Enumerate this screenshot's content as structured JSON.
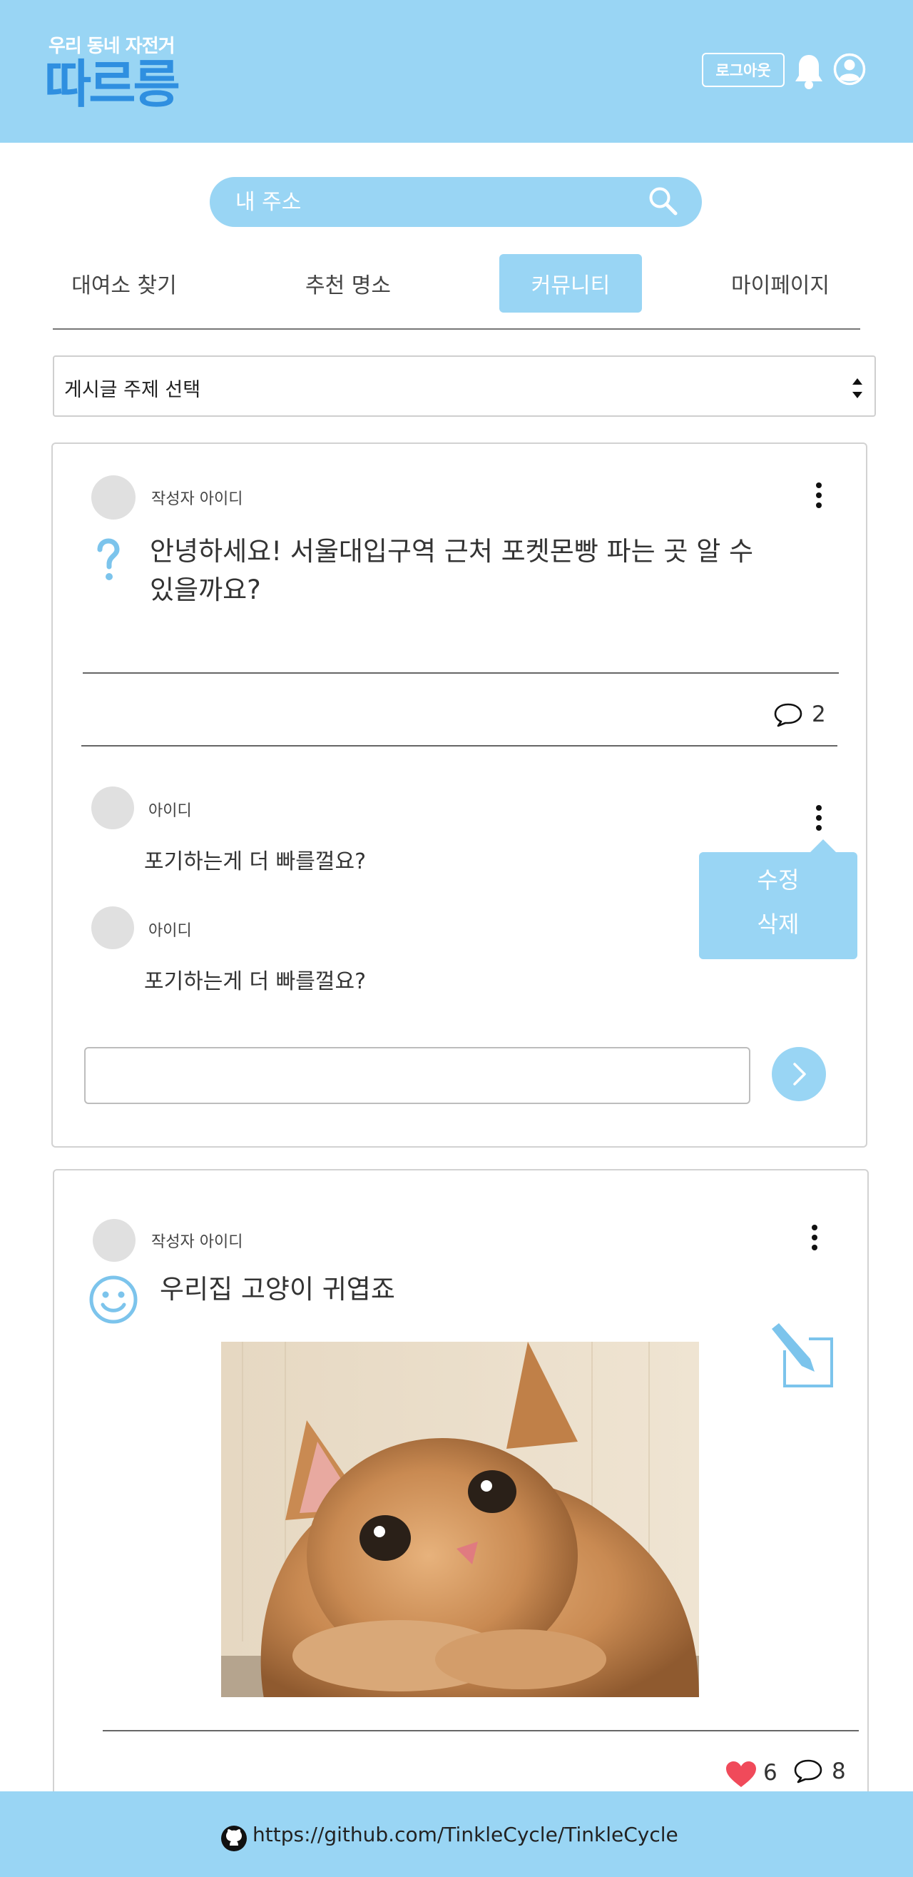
{
  "header": {
    "subtitle": "우리 동네 자전거",
    "logo": "따르릉",
    "logout_label": "로그아웃"
  },
  "search": {
    "placeholder": "내 주소"
  },
  "tabs": [
    {
      "label": "대여소 찾기",
      "active": false
    },
    {
      "label": "추천 명소",
      "active": false
    },
    {
      "label": "커뮤니티",
      "active": true
    },
    {
      "label": "마이페이지",
      "active": false
    }
  ],
  "topic_select": {
    "label": "게시글 주제 선택"
  },
  "posts": [
    {
      "author": "작성자 아이디",
      "icon": "question-icon",
      "title": "안녕하세요! 서울대입구역 근처 포켓몬빵 파는 곳 알 수 있을까요?",
      "title_line1": "안녕하세요! 서울대입구역 근처 포켓몬빵 파는 곳 알 수",
      "title_line2": "있을까요?",
      "comment_count": "2",
      "comments": [
        {
          "author": "아이디",
          "text": "포기하는게 더 빠를껄요?"
        },
        {
          "author": "아이디",
          "text": "포기하는게 더 빠를껄요?"
        }
      ],
      "menu": {
        "edit": "수정",
        "delete": "삭제"
      }
    },
    {
      "author": "작성자 아이디",
      "icon": "smile-icon",
      "title": "우리집 고양이 귀엽죠",
      "like_count": "6",
      "comment_count": "8"
    }
  ],
  "footer": {
    "link": "https://github.com/TinkleCycle/TinkleCycle"
  },
  "colors": {
    "accent": "#99d5f4",
    "brand": "#2f8fe0",
    "heart": "#f04a5a"
  }
}
